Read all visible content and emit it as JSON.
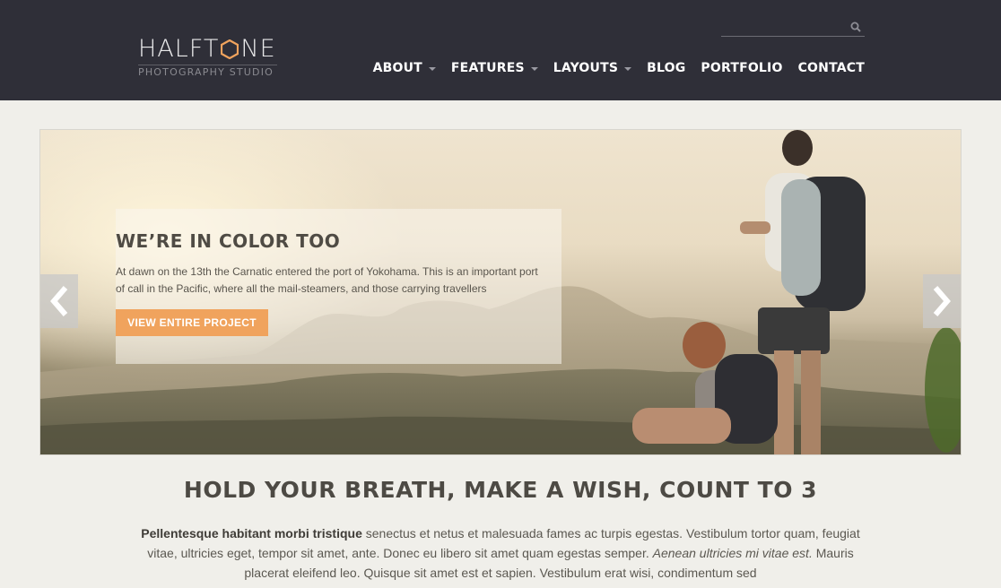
{
  "header": {
    "logo": {
      "word_part1": "HALFT",
      "word_part2": "NE",
      "subtitle": "PHOTOGRAPHY STUDIO",
      "accent": "#f0a35d"
    },
    "search": {
      "placeholder": "",
      "icon": "search-icon"
    },
    "nav": [
      {
        "label": "ABOUT",
        "dropdown": true
      },
      {
        "label": "FEATURES",
        "dropdown": true
      },
      {
        "label": "LAYOUTS",
        "dropdown": true
      },
      {
        "label": "BLOG",
        "dropdown": false
      },
      {
        "label": "PORTFOLIO",
        "dropdown": false
      },
      {
        "label": "CONTACT",
        "dropdown": false
      }
    ]
  },
  "slider": {
    "title": "WE’RE IN COLOR TOO",
    "text": "At dawn on the 13th the Carnatic entered the port of Yokohama. This is an important port of call in the Pacific, where all the mail-steamers, and those carrying travellers",
    "button_label": "VIEW ENTIRE PROJECT",
    "prev_icon": "chevron-left-icon",
    "next_icon": "chevron-right-icon",
    "button_color": "#f0a35d"
  },
  "content": {
    "heading": "HOLD YOUR BREATH, MAKE A WISH, COUNT TO 3",
    "para_bold": "Pellentesque habitant morbi tristique",
    "para_1": " senectus et netus et malesuada fames ac turpis egestas. Vestibulum tortor quam, feugiat vitae, ultricies eget, tempor sit amet, ante. Donec eu libero sit amet quam egestas semper. ",
    "para_italic": "Aenean ultricies mi vitae est.",
    "para_2": " Mauris placerat eleifend leo. Quisque sit amet est et sapien. Vestibulum erat wisi, condimentum sed"
  }
}
